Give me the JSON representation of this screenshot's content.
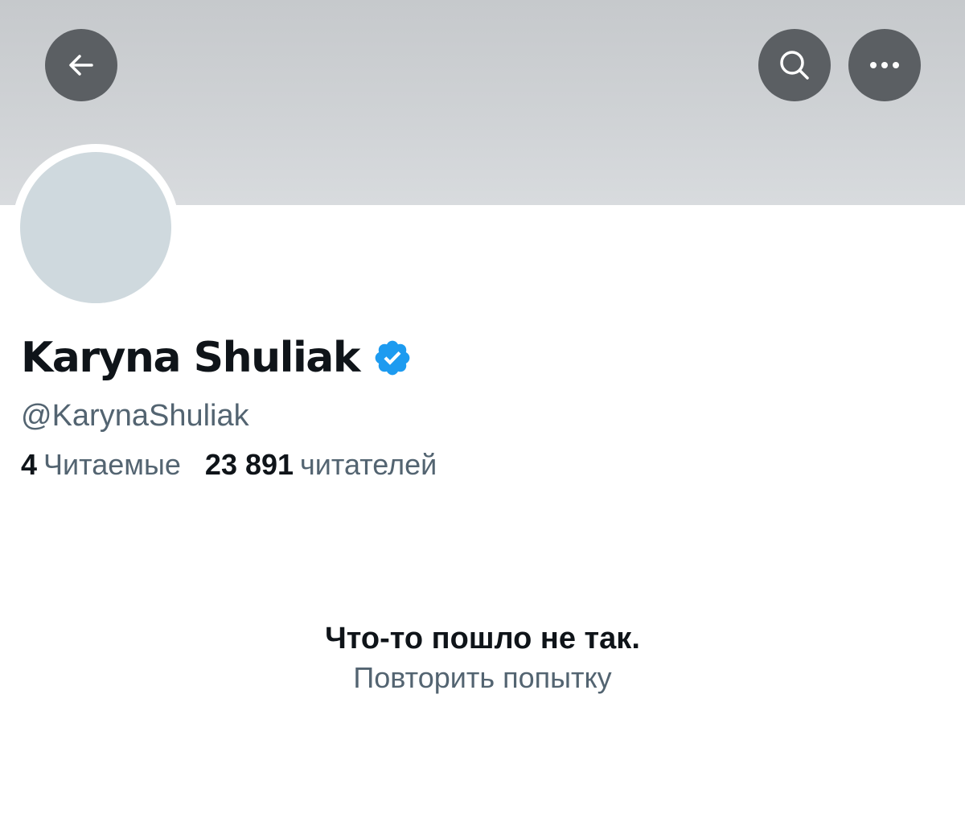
{
  "header": {
    "back_icon": "arrow-left-icon",
    "search_icon": "search-icon",
    "more_icon": "more-horizontal-icon",
    "button_color": "#5b5f63"
  },
  "profile": {
    "display_name": "Karyna Shuliak",
    "verified_icon": "verified-badge-icon",
    "verified_color": "#1d9bf0",
    "handle": "@KarynaShuliak",
    "following_count": "4",
    "following_label": "Читаемые",
    "followers_count": "23 891",
    "followers_label": "читателей"
  },
  "error": {
    "title": "Что-то пошло не так.",
    "retry_label": "Повторить попытку"
  }
}
